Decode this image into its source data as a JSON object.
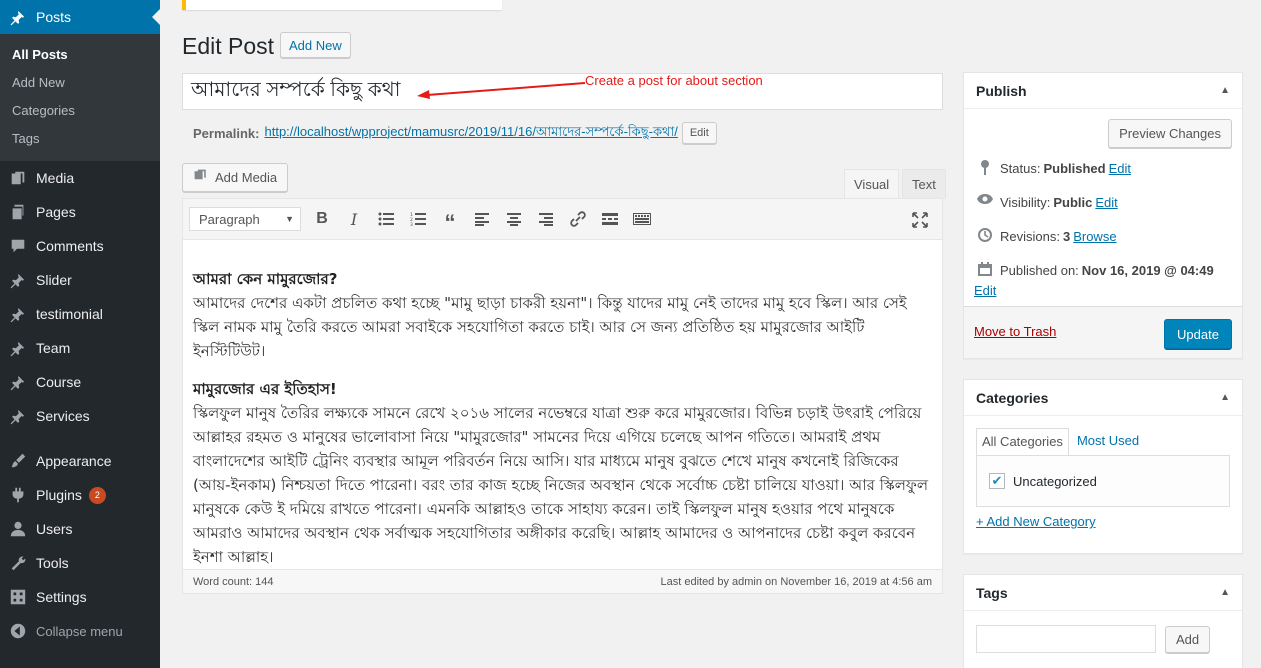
{
  "sidebar": {
    "posts": "Posts",
    "sub": [
      "All Posts",
      "Add New",
      "Categories",
      "Tags"
    ],
    "items": [
      "Media",
      "Pages",
      "Comments",
      "Slider",
      "testimonial",
      "Team",
      "Course",
      "Services"
    ],
    "items2": [
      "Appearance",
      "Plugins",
      "Users",
      "Tools",
      "Settings",
      "Collapse menu"
    ],
    "plugins_badge": "2"
  },
  "header": {
    "title": "Edit Post",
    "add_new": "Add New"
  },
  "post": {
    "title": "আমাদের সম্পর্কে কিছু কথা",
    "annotation": "Create a post for about section",
    "permalink_label": "Permalink:",
    "permalink_url": "http://localhost/wpproject/mamusrc/2019/11/16/আমাদের-সম্পর্কে-কিছু-কথা/",
    "permalink_edit": "Edit"
  },
  "editor": {
    "add_media": "Add Media",
    "tab_visual": "Visual",
    "tab_text": "Text",
    "format": "Paragraph",
    "heading1": "আমরা কেন মামুরজোর?",
    "para1": "আমাদের দেশের একটা প্রচলিত কথা হচ্ছে \"মামু ছাড়া চাকরী হয়না\"। কিন্তু যাদের মামু নেই তাদের মামু হবে স্কিল। আর সেই স্কিল নামক মামু তৈরি করতে আমরা সবাইকে সহযোগিতা করতে চাই। আর সে জন্য প্রতিষ্ঠিত হয় মামুরজোর আইটি ইনস্টিটিউট।",
    "heading2": "মামুরজোর এর ইতিহাস!",
    "para2": "স্কিলফুল মানুষ তৈরির লক্ষ্যকে সামনে রেখে ২০১৬ সালের নভেম্বরে যাত্রা শুরু করে মামুরজোর। বিভিন্ন চড়াই উৎরাই পেরিয়ে আল্লাহর রহমত ও মানুষের ভালোবাসা নিয়ে \"মামুরজোর\" সামনের দিয়ে এগিয়ে চলেছে আপন গতিতে। আমরাই প্রথম বাংলাদেশের আইটি ট্রেনিং ব্যবস্থার আমূল পরিবর্তন নিয়ে আসি। যার মাধ্যমে মানুষ বুঝতে শেখে মানুষ কখনোই রিজিকের (আয়-ইনকাম) নিশ্চয়তা দিতে পারেনা। বরং তার কাজ হচ্ছে নিজের অবস্থান থেকে সর্বোচ্চ চেষ্টা চালিয়ে যাওয়া। আর স্কিলফুল মানুষকে কেউ ই দমিয়ে রাখতে পারেনা। এমনকি আল্লাহও তাকে সাহায্য করেন। তাই স্কিলফুল মানুষ হওয়ার পথে মানুষকে আমরাও আমাদের অবস্থান থেক সর্বাত্মক সহযোগিতার অঙ্গীকার করেছি। আল্লাহ আমাদের ও আপনাদের চেষ্টা কবুল করবেন ইনশা আল্লাহ।",
    "word_count": "Word count: 144",
    "last_edited": "Last edited by admin on November 16, 2019 at 4:56 am"
  },
  "publish": {
    "title": "Publish",
    "preview": "Preview Changes",
    "status_label": "Status:",
    "status_value": "Published",
    "visibility_label": "Visibility:",
    "visibility_value": "Public",
    "revisions_label": "Revisions:",
    "revisions_value": "3",
    "browse": "Browse",
    "published_on_label": "Published on:",
    "published_on_value": "Nov 16, 2019 @ 04:49",
    "edit": "Edit",
    "trash": "Move to Trash",
    "update": "Update"
  },
  "categories": {
    "title": "Categories",
    "tab_all": "All Categories",
    "tab_used": "Most Used",
    "item": "Uncategorized",
    "add_new": "+ Add New Category"
  },
  "tags": {
    "title": "Tags",
    "add": "Add"
  },
  "colors": {
    "admin_bar": "#23282d",
    "accent": "#0073aa",
    "update_button": "#0085ba",
    "annotation": "#e41b17"
  }
}
